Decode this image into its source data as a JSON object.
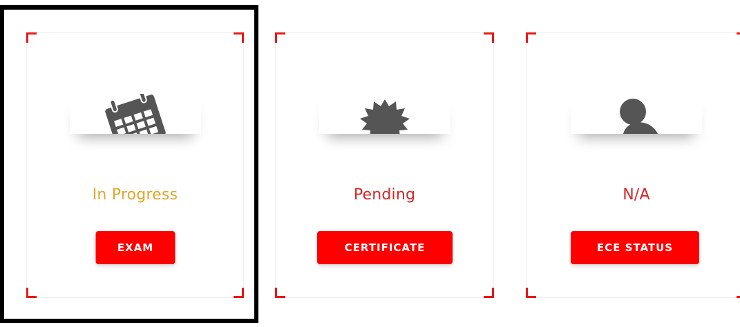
{
  "colors": {
    "accent_red": "#ff0000",
    "corner_red": "#e81818",
    "in_progress": "#e0a72c",
    "icon_gray": "#555555",
    "frame": "#000000"
  },
  "cards": [
    {
      "icon": "calendar-icon",
      "status": "In Progress",
      "button_label": "EXAM"
    },
    {
      "icon": "certificate-badge-icon",
      "status": "Pending",
      "button_label": "CERTIFICATE"
    },
    {
      "icon": "user-icon",
      "status": "N/A",
      "button_label": "ECE STATUS"
    }
  ]
}
